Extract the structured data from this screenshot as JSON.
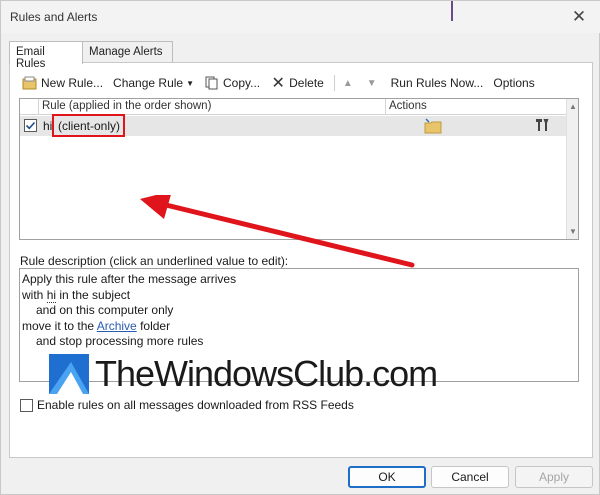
{
  "window": {
    "title": "Rules and Alerts"
  },
  "tabs": [
    {
      "label": "Email Rules",
      "active": true
    },
    {
      "label": "Manage Alerts",
      "active": false
    }
  ],
  "toolbar": {
    "new_rule": "New Rule...",
    "change_rule": "Change Rule",
    "copy": "Copy...",
    "delete": "Delete",
    "run_rules_now": "Run Rules Now...",
    "options": "Options"
  },
  "rules_list": {
    "column_rule": "Rule (applied in the order shown)",
    "column_actions": "Actions",
    "rows": [
      {
        "checked": true,
        "name": "hi",
        "type": "(client-only)"
      }
    ]
  },
  "description": {
    "label": "Rule description (click an underlined value to edit):",
    "line1": "Apply this rule after the message arrives",
    "line2_pre": "with ",
    "line2_value": "hi",
    "line2_post": " in the subject",
    "line3": "and on this computer only",
    "line4_pre": "move it to the ",
    "line4_link": "Archive",
    "line4_post": " folder",
    "line5": "and stop processing more rules"
  },
  "watermark": "TheWindowsClub.com",
  "rss": {
    "label": "Enable rules on all messages downloaded from RSS Feeds",
    "checked": false
  },
  "buttons": {
    "ok": "OK",
    "cancel": "Cancel",
    "apply": "Apply"
  },
  "colors": {
    "annotation_red": "#e0141b",
    "link_blue": "#2a5db0",
    "ok_border": "#1e6ec8"
  }
}
